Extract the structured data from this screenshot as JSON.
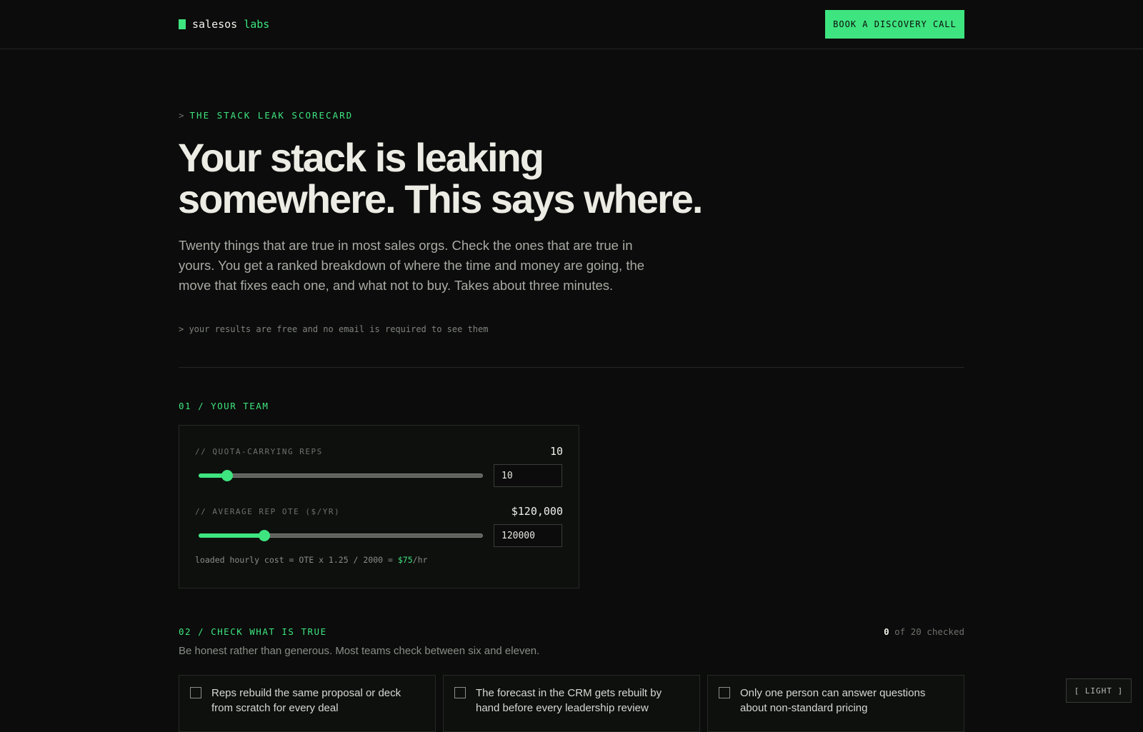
{
  "header": {
    "logo_name": "salesos",
    "logo_accent": "labs",
    "cta_label": "BOOK A DISCOVERY CALL"
  },
  "hero": {
    "eyebrow_prefix": ">",
    "eyebrow": "THE STACK LEAK SCORECARD",
    "title_line1": "Your stack is leaking",
    "title_line2": "somewhere. This says where.",
    "description": "Twenty things that are true in most sales orgs. Check the ones that are true in yours. You get a ranked breakdown of where the time and money are going, the move that fixes each one, and what not to buy. Takes about three minutes.",
    "note": "> your results are free and no email is required to see them"
  },
  "team": {
    "section_label": "01 / YOUR TEAM",
    "reps": {
      "label": "// QUOTA-CARRYING REPS",
      "display": "10",
      "input_value": "10",
      "slider_fraction": 0.1
    },
    "ote": {
      "label": "// AVERAGE REP OTE ($/YR)",
      "display": "$120,000",
      "input_value": "120000",
      "slider_fraction": 0.23
    },
    "formula_prefix": "loaded hourly cost = OTE x 1.25 / 2000 = ",
    "formula_value": "$75",
    "formula_suffix": "/hr"
  },
  "checklist": {
    "section_label": "02 / CHECK WHAT IS TRUE",
    "checked_count": "0",
    "checked_suffix": "of 20 checked",
    "subtitle": "Be honest rather than generous. Most teams check between six and eleven.",
    "items": [
      {
        "text": "Reps rebuild the same proposal or deck from scratch for every deal"
      },
      {
        "text": "The forecast in the CRM gets rebuilt by hand before every leadership review"
      },
      {
        "text": "Only one person can answer questions about non-standard pricing"
      }
    ]
  },
  "theme_toggle_label": "[ LIGHT ]",
  "colors": {
    "background": "#0b0c0b",
    "accent": "#3ee47f",
    "text": "#e8e8e2",
    "muted": "#8a8d87"
  }
}
